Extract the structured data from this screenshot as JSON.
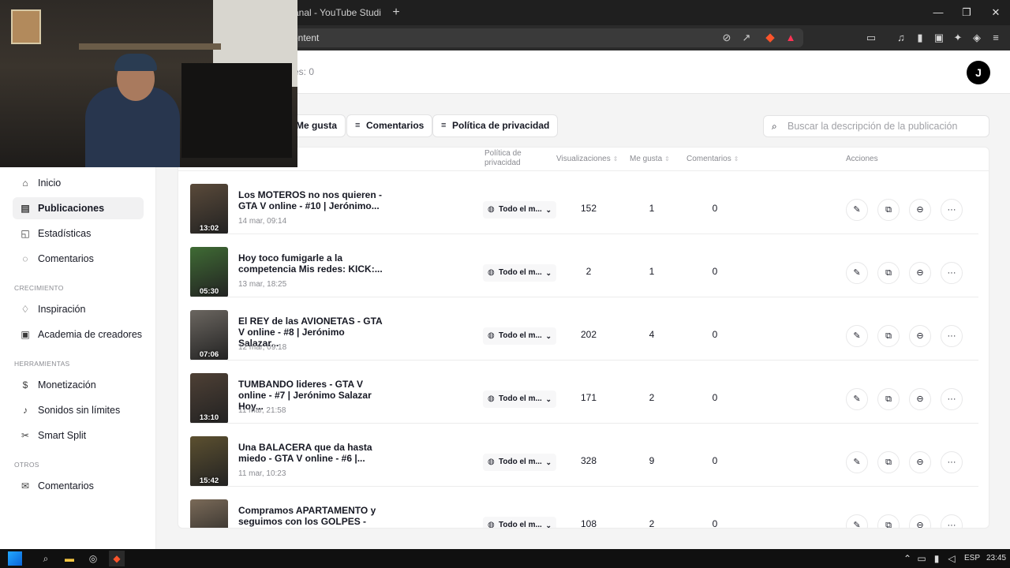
{
  "browser": {
    "tab_title": "l canal - YouTube Studi",
    "new_tab": "+",
    "url_text": "ontent",
    "window_controls": [
      "—",
      "❐",
      "✕"
    ]
  },
  "header": {
    "meta_text": "res: 0",
    "avatar_letter": "J"
  },
  "sidebar": {
    "items_main": [
      {
        "label": "Inicio",
        "icon": "home-icon",
        "glyph": "⌂",
        "active": false
      },
      {
        "label": "Publicaciones",
        "icon": "folder-icon",
        "glyph": "▤",
        "active": true
      },
      {
        "label": "Estadísticas",
        "icon": "analytics-icon",
        "glyph": "◱",
        "active": false
      },
      {
        "label": "Comentarios",
        "icon": "comment-icon",
        "glyph": "◌",
        "active": false
      }
    ],
    "section_growth": "CRECIMIENTO",
    "items_growth": [
      {
        "label": "Inspiración",
        "icon": "lightbulb-icon",
        "glyph": "♢"
      },
      {
        "label": "Academia de creadores",
        "icon": "book-icon",
        "glyph": "▣"
      }
    ],
    "section_tools": "HERRAMIENTAS",
    "items_tools": [
      {
        "label": "Monetización",
        "icon": "money-icon",
        "glyph": "$"
      },
      {
        "label": "Sonidos sin límites",
        "icon": "music-icon",
        "glyph": "♪"
      },
      {
        "label": "Smart Split",
        "icon": "scissors-icon",
        "glyph": "✂"
      }
    ],
    "section_other": "OTROS",
    "items_other": [
      {
        "label": "Comentarios",
        "icon": "mail-icon",
        "glyph": "✉"
      }
    ]
  },
  "filters": {
    "likes": "Me gusta",
    "comments": "Comentarios",
    "privacy": "Política de privacidad"
  },
  "search": {
    "placeholder": "Buscar la descripción de la publicación",
    "value": ""
  },
  "table": {
    "headers": {
      "privacy_line1": "Política de",
      "privacy_line2": "privacidad",
      "views": "Visualizaciones",
      "likes": "Me gusta",
      "comments": "Comentarios",
      "actions": "Acciones"
    },
    "rows": [
      {
        "title": "Los MOTEROS no nos quieren - GTA V online - #10 | Jerónimo...",
        "date": "14 mar, 09:14",
        "duration": "13:02",
        "privacy": "Todo el m...",
        "views": "152",
        "likes": "1",
        "comments": "0",
        "thumb_color": "#5a4a3a"
      },
      {
        "title": "Hoy toco fumigarle a la competencia Mis redes: KICK:...",
        "date": "13 mar, 18:25",
        "duration": "05:30",
        "privacy": "Todo el m...",
        "views": "2",
        "likes": "1",
        "comments": "0",
        "thumb_color": "#3f6b34"
      },
      {
        "title": "El REY de las AVIONETAS - GTA V online - #8 | Jerónimo Salazar...",
        "date": "12 mar, 09:18",
        "duration": "07:06",
        "privacy": "Todo el m...",
        "views": "202",
        "likes": "4",
        "comments": "0",
        "thumb_color": "#6b6660"
      },
      {
        "title": "TUMBANDO lideres - GTA V online - #7 | Jerónimo Salazar Hoy...",
        "date": "11 mar, 21:58",
        "duration": "13:10",
        "privacy": "Todo el m...",
        "views": "171",
        "likes": "2",
        "comments": "0",
        "thumb_color": "#4e4035"
      },
      {
        "title": "Una BALACERA que da hasta miedo - GTA V online - #6 |...",
        "date": "11 mar, 10:23",
        "duration": "15:42",
        "privacy": "Todo el m...",
        "views": "328",
        "likes": "9",
        "comments": "0",
        "thumb_color": "#5c5030"
      },
      {
        "title": "Compramos APARTAMENTO y seguimos con los GOLPES - GTA ...",
        "date": "",
        "duration": "",
        "privacy": "Todo el m...",
        "views": "108",
        "likes": "2",
        "comments": "0",
        "thumb_color": "#7a6a58"
      }
    ],
    "action_icons": [
      {
        "name": "edit-icon",
        "glyph": "✎"
      },
      {
        "name": "promote-icon",
        "glyph": "⧉"
      },
      {
        "name": "comment-icon",
        "glyph": "⊖"
      },
      {
        "name": "more-icon",
        "glyph": "···"
      }
    ]
  },
  "taskbar": {
    "language": "ESP",
    "time": "23:45"
  }
}
